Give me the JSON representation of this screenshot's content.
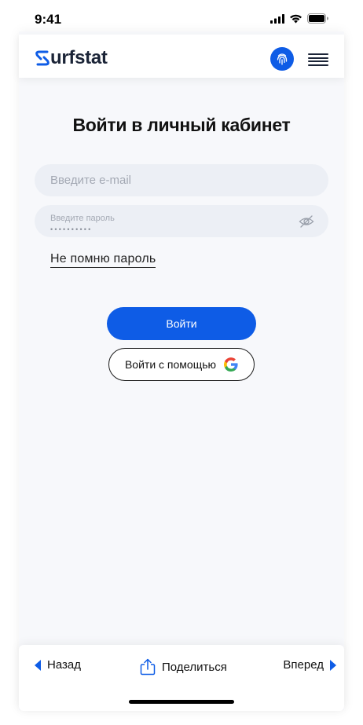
{
  "status_bar": {
    "time": "9:41"
  },
  "header": {
    "logo_text": "urfstat"
  },
  "login": {
    "title": "Войти в личный кабинет",
    "email_placeholder": "Введите e-mail",
    "password_label": "Введите пароль",
    "password_mask": "••••••••••",
    "forgot_link": "Не помню пароль",
    "submit_label": "Войти",
    "google_label": "Войти с помощью"
  },
  "bottom_bar": {
    "back_label": "Назад",
    "share_label": "Поделиться",
    "forward_label": "Вперед"
  },
  "colors": {
    "accent": "#0e5ce6",
    "background": "#f7f8fb",
    "field": "#eceff5"
  },
  "icons": [
    "signal-icon",
    "wifi-icon",
    "battery-icon",
    "fingerprint-icon",
    "menu-icon",
    "eye-off-icon",
    "google-icon",
    "share-icon"
  ]
}
